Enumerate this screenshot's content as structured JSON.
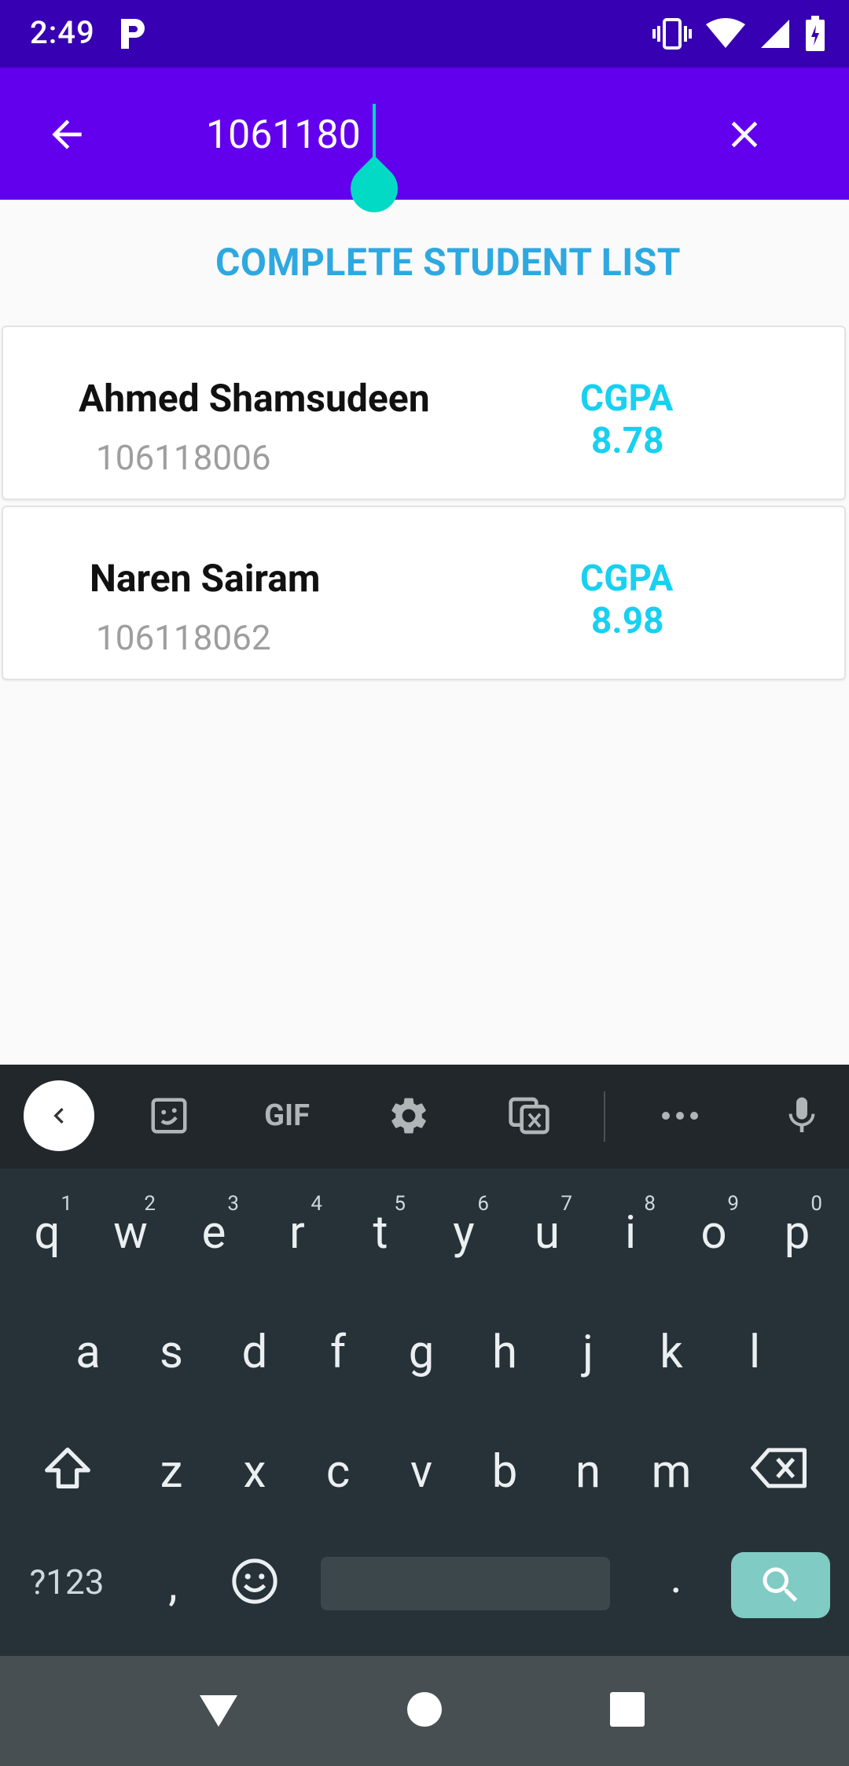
{
  "status_bar": {
    "time": "2:49"
  },
  "search": {
    "value": "1061180",
    "placeholder": ""
  },
  "list": {
    "title": "COMPLETE STUDENT LIST",
    "students": [
      {
        "name": "Ahmed Shamsudeen",
        "id": "106118006",
        "cgpa_label": "CGPA",
        "cgpa": "8.78"
      },
      {
        "name": "Naren Sairam",
        "id": "106118062",
        "cgpa_label": "CGPA",
        "cgpa": "8.98"
      }
    ]
  },
  "keyboard": {
    "toolbar": {
      "gif_label": "GIF"
    },
    "row1": [
      "q",
      "w",
      "e",
      "r",
      "t",
      "y",
      "u",
      "i",
      "o",
      "p"
    ],
    "row1_hints": [
      "1",
      "2",
      "3",
      "4",
      "5",
      "6",
      "7",
      "8",
      "9",
      "0"
    ],
    "row2": [
      "a",
      "s",
      "d",
      "f",
      "g",
      "h",
      "j",
      "k",
      "l"
    ],
    "row3": [
      "z",
      "x",
      "c",
      "v",
      "b",
      "n",
      "m"
    ],
    "symbols_label": "?123",
    "comma": ",",
    "period": "."
  },
  "colors": {
    "status_bar": "#3700b3",
    "app_bar": "#6200ee",
    "title": "#2ea8e0",
    "cgpa": "#18d0f0",
    "caret": "#03dac5"
  }
}
